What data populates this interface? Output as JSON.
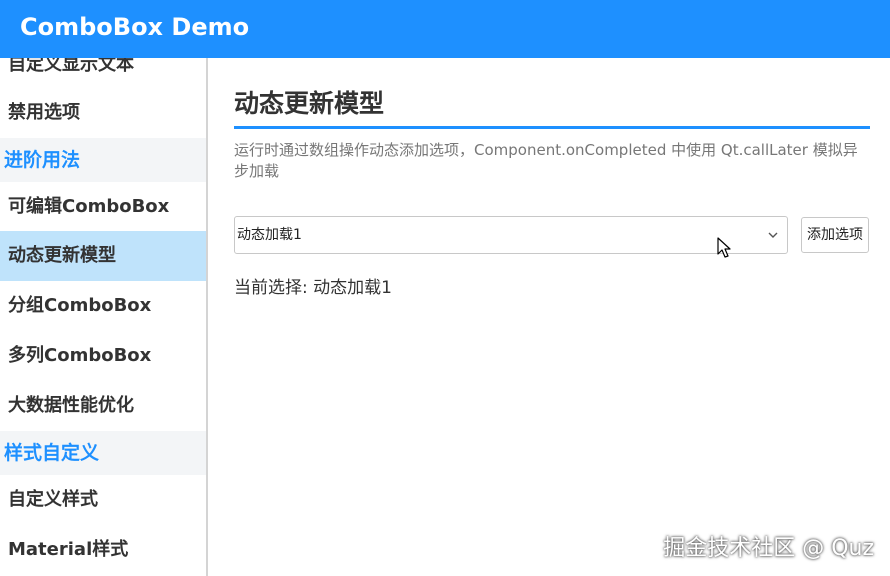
{
  "window": {
    "title": "ComboBox Demo"
  },
  "sidebar": {
    "items": [
      {
        "label": "自定义显示文本"
      },
      {
        "label": "禁用选项"
      },
      {
        "label": "进阶用法"
      },
      {
        "label": "可编辑ComboBox"
      },
      {
        "label": "动态更新模型"
      },
      {
        "label": "分组ComboBox"
      },
      {
        "label": "多列ComboBox"
      },
      {
        "label": "大数据性能优化"
      },
      {
        "label": "样式自定义"
      },
      {
        "label": "自定义样式"
      },
      {
        "label": "Material样式"
      }
    ]
  },
  "main": {
    "title": "动态更新模型",
    "description": "运行时通过数组操作动态添加选项，Component.onCompleted 中使用 Qt.callLater 模拟异步加载",
    "combo": {
      "value": "动态加载1"
    },
    "add_button_label": "添加选项",
    "current_selection_label": "当前选择: ",
    "current_selection_value": "动态加载1"
  },
  "watermark": "掘金技术社区 @ Quz",
  "colors": {
    "accent": "#1e90ff",
    "active_item_bg": "#bfe3fb",
    "section_header_bg": "#f3f5f7"
  },
  "icons": {
    "combo_arrow": "chevron-down-icon",
    "cursor": "mouse-pointer-icon"
  }
}
